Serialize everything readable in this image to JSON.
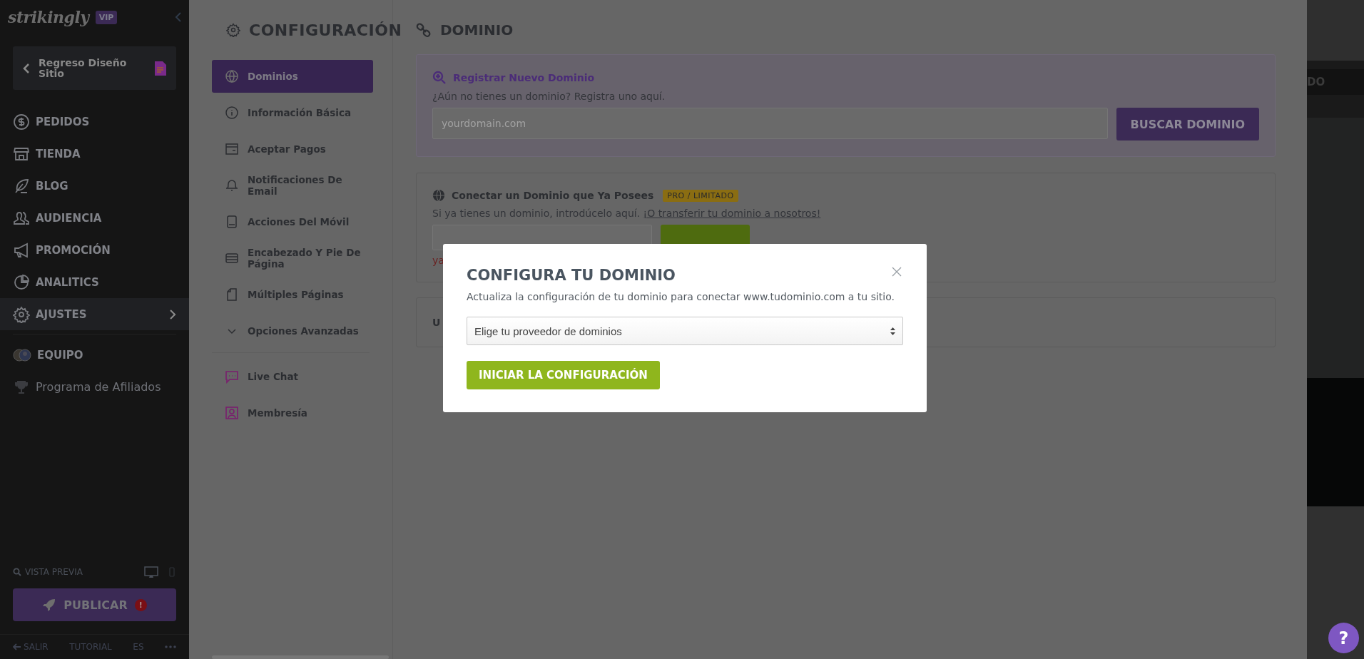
{
  "sidebar": {
    "logo": "strikingly",
    "badge": "VIP",
    "back_button": "Regreso Diseño Sitio",
    "items": [
      {
        "label": "PEDIDOS",
        "selected": false
      },
      {
        "label": "TIENDA",
        "selected": false
      },
      {
        "label": "BLOG",
        "selected": false
      },
      {
        "label": "AUDIENCIA",
        "selected": false
      },
      {
        "label": "PROMOCIÓN",
        "selected": false
      },
      {
        "label": "ANALITICS",
        "selected": false
      },
      {
        "label": "AJUSTES",
        "selected": true
      }
    ],
    "team_item": "EQUIPO",
    "affiliate_item": "Programa de Afiliados",
    "preview_label": "VISTA PREVIA",
    "publish_button": "PUBLICAR",
    "publish_alert": "!",
    "footer": [
      "SALIR",
      "TUTORIAL",
      "ES"
    ]
  },
  "settings": {
    "title": "CONFIGURACIÓN",
    "nav": [
      {
        "label": "Dominios",
        "selected": true
      },
      {
        "label": "Información Básica",
        "selected": false
      },
      {
        "label": "Aceptar Pagos",
        "selected": false
      },
      {
        "label": "Notificaciones De Email",
        "selected": false
      },
      {
        "label": "Acciones Del Móvil",
        "selected": false
      },
      {
        "label": "Encabezado Y Pie De Página",
        "selected": false
      },
      {
        "label": "Múltiples Páginas",
        "selected": false
      },
      {
        "label": "Opciones Avanzadas",
        "selected": false
      }
    ],
    "extra_nav": [
      {
        "label": "Live Chat",
        "selected": false
      },
      {
        "label": "Membresía",
        "selected": false
      }
    ]
  },
  "domain": {
    "title": "DOMINIO",
    "register": {
      "heading": "Registrar Nuevo Dominio",
      "prompt": "¿Aún no tienes un dominio? Registra uno aquí.",
      "placeholder": "yourdomain.com",
      "button": "BUSCAR DOMINIO"
    },
    "connect": {
      "heading": "Conectar un Dominio que Ya Posees",
      "badge": "PRO / LIMITADO",
      "prompt": "Si ya tienes un dominio, introdúcelo aquí.",
      "link": "¡O transferir tu dominio a nosotros!",
      "error_fragment": "ya"
    },
    "third_card": {
      "label_fragment": "U"
    }
  },
  "preview_pane": {
    "button_fragment": "DO"
  },
  "modal": {
    "title": "CONFIGURA TU DOMINIO",
    "text": "Actualiza la configuración de tu dominio para conectar www.tudominio.com a tu sitio.",
    "select": "Elige tu proveedor de dominios",
    "button": "INICIAR LA CONFIGURACIÓN"
  },
  "help_button": "?"
}
